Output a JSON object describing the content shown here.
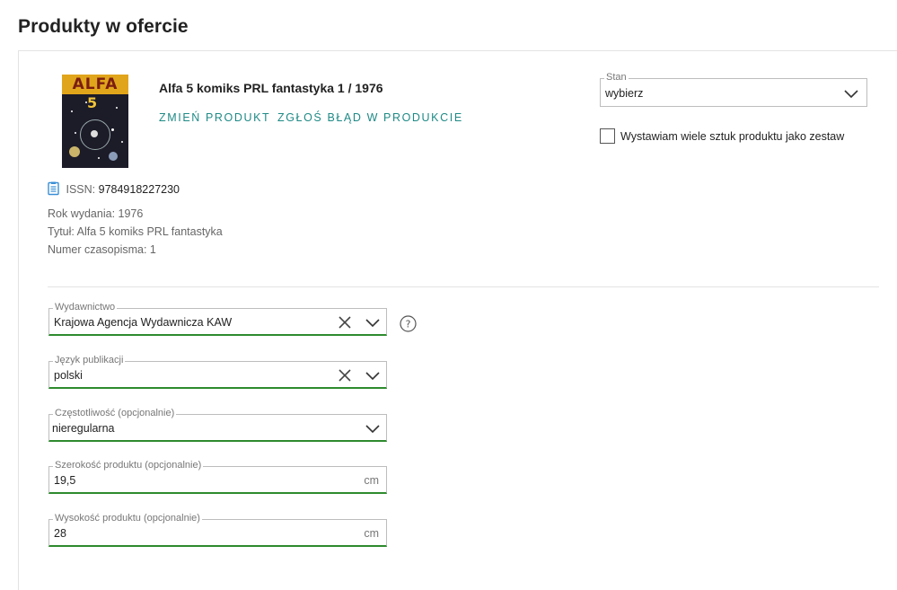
{
  "page": {
    "title": "Produkty w ofercie"
  },
  "product": {
    "name": "Alfa 5 komiks PRL fantastyka 1 / 1976",
    "cover": {
      "logo_text": "ALFA",
      "number_text": "5"
    },
    "change_link": "ZMIEŃ PRODUKT",
    "report_link": "ZGŁOŚ BŁĄD W PRODUKCIE",
    "issn_label": "ISSN:",
    "issn_value": "9784918227230",
    "attributes": [
      "Rok wydania: 1976",
      "Tytuł: Alfa 5 komiks PRL fantastyka",
      "Numer czasopisma: 1"
    ]
  },
  "condition": {
    "label": "Stan",
    "value": "wybierz",
    "set_checkbox_label": "Wystawiam wiele sztuk produktu jako zestaw",
    "set_checkbox_checked": false
  },
  "fields": {
    "publisher": {
      "label": "Wydawnictwo",
      "value": "Krajowa Agencja Wydawnicza KAW"
    },
    "language": {
      "label": "Język publikacji",
      "value": "polski"
    },
    "frequency": {
      "label": "Częstotliwość (opcjonalnie)",
      "value": "nieregularna"
    },
    "width": {
      "label": "Szerokość produktu (opcjonalnie)",
      "value": "19,5",
      "unit": "cm"
    },
    "height": {
      "label": "Wysokość produktu (opcjonalnie)",
      "value": "28",
      "unit": "cm"
    }
  },
  "colors": {
    "accent_link": "#1f8a86",
    "field_underline_valid": "#2e8b2e",
    "issn_icon": "#3a8fd6"
  },
  "icons": {
    "clear": "close-icon",
    "dropdown": "chevron-down-icon",
    "help": "help-icon",
    "issn": "document-icon"
  }
}
